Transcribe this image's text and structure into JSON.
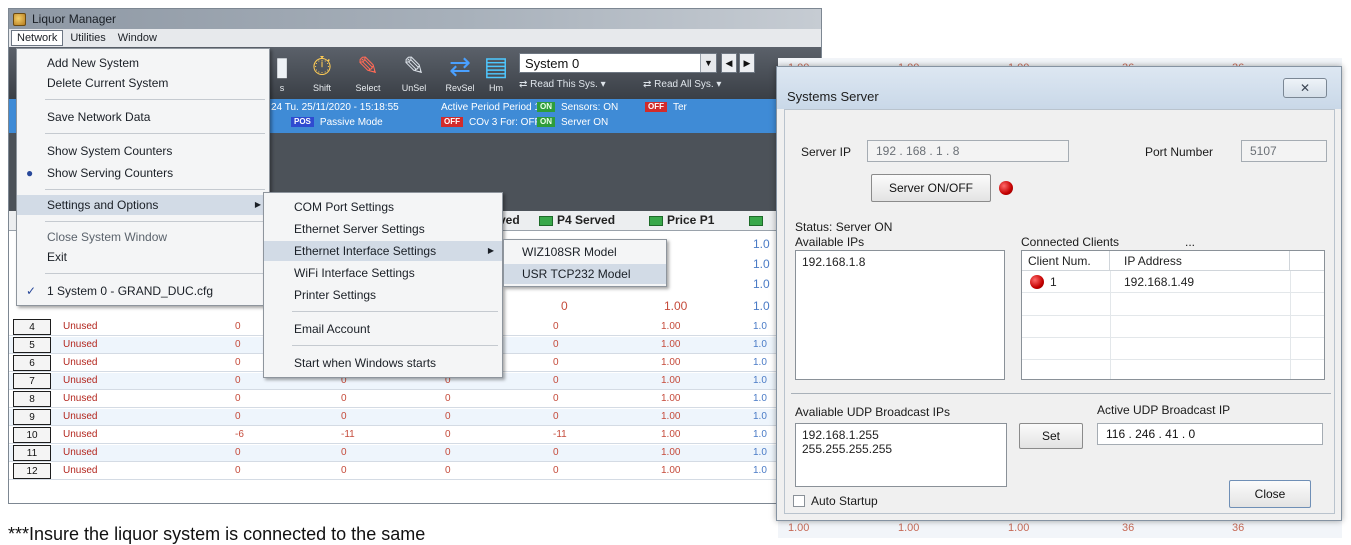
{
  "app": {
    "title": "Liquor Manager",
    "menubar": [
      "Network",
      "Utilities",
      "Window"
    ],
    "toolbar": {
      "buttons": [
        "Shift",
        "Select",
        "UnSel",
        "RevSel",
        "Hm"
      ],
      "system_select": "System 0",
      "read_this_sys": "Read This Sys.",
      "read_all_sys": "Read All Sys."
    },
    "status": {
      "date": "24  Tu. 25/11/2020 - 15:18:55",
      "period": "Active Period  Period 1",
      "sensors": "Sensors: ON",
      "sensors_badge": "ON",
      "ter": "Ter",
      "ter_badge": "OFF",
      "passive_badge": "POS",
      "passive": "Passive Mode",
      "cov": "COv 3 For: OFF",
      "cov_badge": "OFF",
      "server": "Server ON",
      "server_badge": "ON"
    },
    "grid": {
      "headers": [
        "ved",
        "P4 Served",
        "Price P1"
      ],
      "rows": [
        {
          "num": "4",
          "name": "Unused",
          "c1": "0",
          "c2": "",
          "c3": "",
          "c4": "0",
          "price": "1.00",
          "last": "1.0"
        },
        {
          "num": "5",
          "name": "Unused",
          "c1": "0",
          "c2": "",
          "c3": "",
          "c4": "0",
          "price": "1.00",
          "last": "1.0"
        },
        {
          "num": "6",
          "name": "Unused",
          "c1": "0",
          "c2": "",
          "c3": "",
          "c4": "0",
          "price": "1.00",
          "last": "1.0"
        },
        {
          "num": "7",
          "name": "Unused",
          "c1": "0",
          "c2": "0",
          "c3": "0",
          "c4": "0",
          "price": "1.00",
          "last": "1.0"
        },
        {
          "num": "8",
          "name": "Unused",
          "c1": "0",
          "c2": "0",
          "c3": "0",
          "c4": "0",
          "price": "1.00",
          "last": "1.0"
        },
        {
          "num": "9",
          "name": "Unused",
          "c1": "0",
          "c2": "0",
          "c3": "0",
          "c4": "0",
          "price": "1.00",
          "last": "1.0"
        },
        {
          "num": "10",
          "name": "Unused",
          "c1": "-6",
          "c2": "-11",
          "c3": "0",
          "c4": "-11",
          "price": "1.00",
          "last": "1.0"
        },
        {
          "num": "11",
          "name": "Unused",
          "c1": "0",
          "c2": "0",
          "c3": "0",
          "c4": "0",
          "price": "1.00",
          "last": "1.0"
        },
        {
          "num": "12",
          "name": "Unused",
          "c1": "0",
          "c2": "0",
          "c3": "0",
          "c4": "0",
          "price": "1.00",
          "last": "1.0"
        }
      ],
      "upper_right_values": [
        "1.0",
        "1.0",
        "1.0",
        "1.0"
      ]
    },
    "network_menu": {
      "items": [
        "Add New System",
        "Delete Current System",
        "Save Network Data",
        "Show System Counters",
        "Show Serving Counters",
        "Settings and Options",
        "Close System Window",
        "Exit",
        "1 System 0 - GRAND_DUC.cfg"
      ]
    },
    "settings_menu": {
      "items": [
        "COM Port Settings",
        "Ethernet Server Settings",
        "Ethernet Interface Settings",
        "WiFi Interface Settings",
        "Printer Settings",
        "Email Account",
        "Start when Windows starts"
      ]
    },
    "ethernet_menu": {
      "items": [
        "WIZ108SR Model",
        "USR TCP232 Model"
      ]
    }
  },
  "caption": "***Insure the liquor system is connected to the same",
  "server_dialog": {
    "title": "Systems Server",
    "server_ip_label": "Server IP",
    "server_ip": "192  .  168  .  1   .  8",
    "port_label": "Port Number",
    "port": "5107",
    "on_off_button": "Server ON/OFF",
    "status": "Status:  Server ON",
    "available_ips_label": "Available IPs",
    "available_ips": [
      "192.168.1.8"
    ],
    "connected_clients_label": "Connected Clients",
    "connected_clients_more": "...",
    "clients_headers": [
      "Client Num.",
      "IP Address"
    ],
    "clients": [
      {
        "num": "1",
        "ip": "192.168.1.49"
      }
    ],
    "udp_broadcast_label": "Avaliable UDP Broadcast IPs",
    "udp_broadcast_ips": [
      "192.168.1.255",
      "255.255.255.255"
    ],
    "set_button": "Set",
    "active_udp_label": "Active UDP Broadcast IP",
    "active_udp_ip": "116   .   246   .   41   .   0",
    "auto_startup": "Auto Startup",
    "close_button": "Close"
  },
  "background_values": {
    "top": [
      "1.00",
      "1.00",
      "1.00",
      "36",
      "36"
    ],
    "bottom": [
      "1.00",
      "1.00",
      "1.00",
      "36",
      "36"
    ]
  },
  "colors": {
    "status_bar": "#3f8bd6",
    "toolbar": "#3a3f46",
    "error_red": "#c40000"
  }
}
